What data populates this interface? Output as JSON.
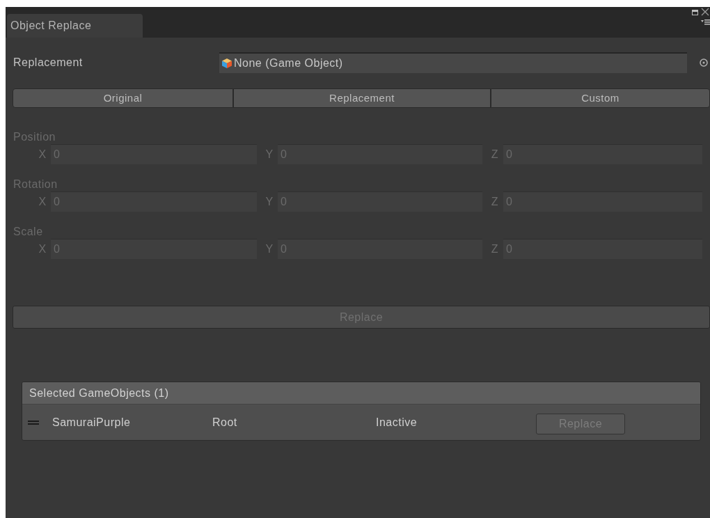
{
  "window": {
    "tab": "Object Replace"
  },
  "replacement": {
    "label": "Replacement",
    "value": "None (Game Object)"
  },
  "modes": [
    {
      "label": "Original",
      "selected": false
    },
    {
      "label": "Replacement",
      "selected": false
    },
    {
      "label": "Custom",
      "selected": false
    }
  ],
  "transform": [
    {
      "label": "Position",
      "disabled": true,
      "fields": [
        {
          "axis": "X",
          "value": "0"
        },
        {
          "axis": "Y",
          "value": "0"
        },
        {
          "axis": "Z",
          "value": "0"
        }
      ]
    },
    {
      "label": "Rotation",
      "disabled": true,
      "fields": [
        {
          "axis": "X",
          "value": "0"
        },
        {
          "axis": "Y",
          "value": "0"
        },
        {
          "axis": "Z",
          "value": "0"
        }
      ]
    },
    {
      "label": "Scale",
      "disabled": true,
      "fields": [
        {
          "axis": "X",
          "value": "0"
        },
        {
          "axis": "Y",
          "value": "0"
        },
        {
          "axis": "Z",
          "value": "0"
        }
      ]
    }
  ],
  "replace_button": {
    "label": "Replace",
    "disabled": true
  },
  "selected_list": {
    "title": "Selected GameObjects (1)",
    "rows": [
      {
        "name": "SamuraiPurple",
        "parent": "Root",
        "state": "Inactive",
        "button": "Replace",
        "button_disabled": true
      }
    ]
  }
}
